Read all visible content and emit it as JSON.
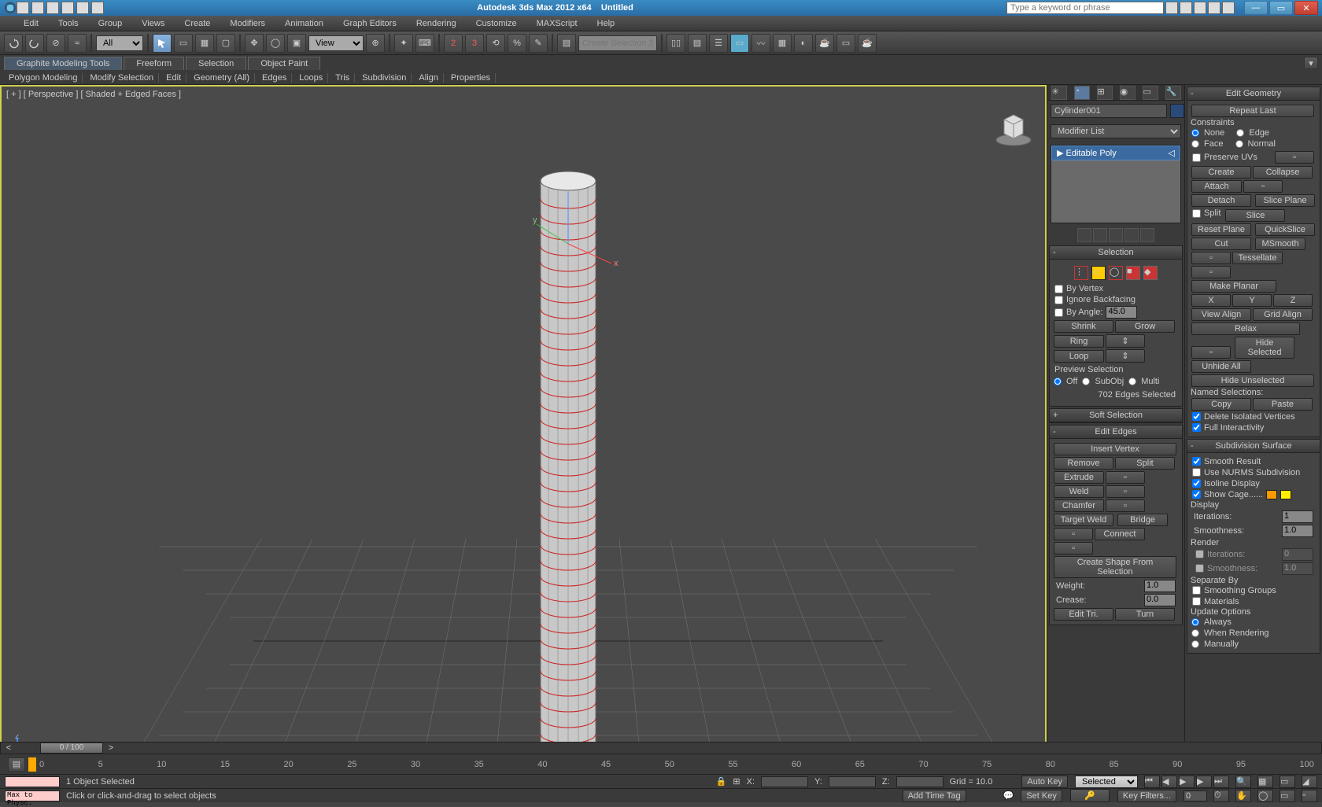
{
  "titlebar": {
    "app": "Autodesk 3ds Max 2012 x64",
    "doc": "Untitled",
    "search_placeholder": "Type a keyword or phrase"
  },
  "menu": [
    "Edit",
    "Tools",
    "Group",
    "Views",
    "Create",
    "Modifiers",
    "Animation",
    "Graph Editors",
    "Rendering",
    "Customize",
    "MAXScript",
    "Help"
  ],
  "toolbar": {
    "filter": "All",
    "view_select": "View",
    "snap": "3",
    "create_sel_placeholder": "Create Selection Se"
  },
  "ribbon_tabs": [
    "Graphite Modeling Tools",
    "Freeform",
    "Selection",
    "Object Paint"
  ],
  "ribbon_sub": [
    "Polygon Modeling",
    "Modify Selection",
    "Edit",
    "Geometry (All)",
    "Edges",
    "Loops",
    "Tris",
    "Subdivision",
    "Align",
    "Properties"
  ],
  "viewport": {
    "label": "[ + ] [ Perspective ] [ Shaded + Edged Faces ]"
  },
  "cmd": {
    "object_name": "Cylinder001",
    "mod_list": "Modifier List",
    "mod_item": "Editable Poly",
    "selection": {
      "title": "Selection",
      "by_vertex": "By Vertex",
      "ignore_backfacing": "Ignore Backfacing",
      "by_angle": "By Angle:",
      "angle_val": "45.0",
      "shrink": "Shrink",
      "grow": "Grow",
      "ring": "Ring",
      "loop": "Loop",
      "preview": "Preview Selection",
      "off": "Off",
      "subobj": "SubObj",
      "multi": "Multi",
      "count": "702 Edges Selected"
    },
    "soft_sel": "Soft Selection",
    "edit_edges": {
      "title": "Edit Edges",
      "insert_vertex": "Insert Vertex",
      "remove": "Remove",
      "split": "Split",
      "extrude": "Extrude",
      "weld": "Weld",
      "chamfer": "Chamfer",
      "target_weld": "Target Weld",
      "bridge": "Bridge",
      "connect": "Connect",
      "create_shape": "Create Shape From Selection",
      "weight": "Weight:",
      "weight_val": "1.0",
      "crease": "Crease:",
      "crease_val": "0.0",
      "edit_tri": "Edit Tri.",
      "turn": "Turn"
    }
  },
  "geom": {
    "title": "Edit Geometry",
    "repeat": "Repeat Last",
    "constraints": "Constraints",
    "none": "None",
    "edge": "Edge",
    "face": "Face",
    "normal": "Normal",
    "preserve_uvs": "Preserve UVs",
    "create": "Create",
    "collapse": "Collapse",
    "attach": "Attach",
    "detach": "Detach",
    "slice_plane": "Slice Plane",
    "split": "Split",
    "slice": "Slice",
    "reset_plane": "Reset Plane",
    "quickslice": "QuickSlice",
    "cut": "Cut",
    "msmooth": "MSmooth",
    "tessellate": "Tessellate",
    "make_planar": "Make Planar",
    "view_align": "View Align",
    "grid_align": "Grid Align",
    "relax": "Relax",
    "hide_sel": "Hide Selected",
    "unhide": "Unhide All",
    "hide_unsel": "Hide Unselected",
    "named_sel": "Named Selections:",
    "copy": "Copy",
    "paste": "Paste",
    "del_iso": "Delete Isolated Vertices",
    "full_int": "Full Interactivity"
  },
  "subsurf": {
    "title": "Subdivision Surface",
    "smooth": "Smooth Result",
    "nurms": "Use NURMS Subdivision",
    "isoline": "Isoline Display",
    "show_cage": "Show Cage......",
    "display": "Display",
    "iterations": "Iterations:",
    "iter_val": "1",
    "smoothness": "Smoothness:",
    "smooth_val": "1.0",
    "render": "Render",
    "r_iter_val": "0",
    "r_smooth_val": "1.0",
    "sep_by": "Separate By",
    "sep_smooth": "Smoothing Groups",
    "sep_mat": "Materials",
    "update": "Update Options",
    "always": "Always",
    "when_render": "When Rendering",
    "manually": "Manually"
  },
  "time": {
    "handle": "0 / 100",
    "marks": [
      "0",
      "5",
      "10",
      "15",
      "20",
      "25",
      "30",
      "35",
      "40",
      "45",
      "50",
      "55",
      "60",
      "65",
      "70",
      "75",
      "80",
      "85",
      "90",
      "95",
      "100"
    ]
  },
  "status": {
    "sel": "1 Object Selected",
    "prompt": "Click or click-and-drag to select objects",
    "x": "X:",
    "y": "Y:",
    "z": "Z:",
    "grid": "Grid = 10.0",
    "autokey": "Auto Key",
    "selected": "Selected",
    "setkey": "Set Key",
    "keyfilters": "Key Filters...",
    "add_time_tag": "Add Time Tag",
    "max_physc": "Max to Physc."
  }
}
